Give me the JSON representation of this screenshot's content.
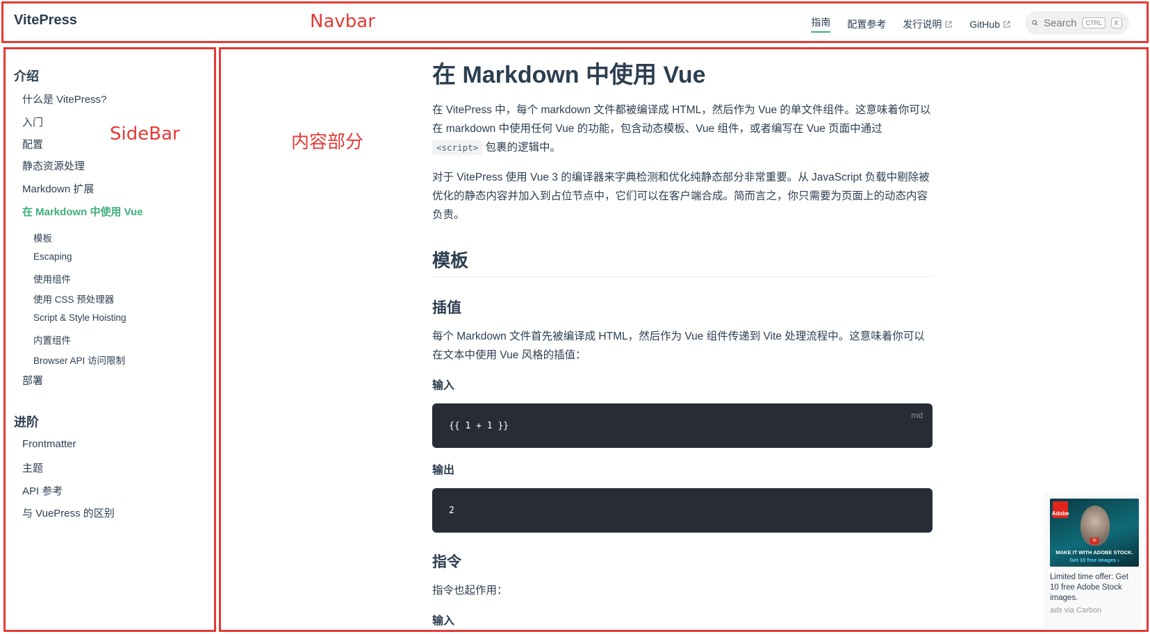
{
  "navbar": {
    "brand": "VitePress",
    "links": [
      {
        "label": "指南",
        "active": true,
        "external": false
      },
      {
        "label": "配置参考",
        "active": false,
        "external": false
      },
      {
        "label": "发行说明",
        "active": false,
        "external": true
      },
      {
        "label": "GitHub",
        "active": false,
        "external": true
      }
    ],
    "search": {
      "label": "Search",
      "kbd_ctrl": "CTRL",
      "kbd_key": "K"
    }
  },
  "annotations": {
    "navbar": "Navbar",
    "sidebar": "SideBar",
    "content": "内容部分"
  },
  "sidebar": {
    "groups": [
      {
        "title": "介绍",
        "items": [
          {
            "label": "什么是 VitePress?"
          },
          {
            "label": "入门"
          },
          {
            "label": "配置"
          },
          {
            "label": "静态资源处理"
          },
          {
            "label": "Markdown 扩展"
          },
          {
            "label": "在 Markdown 中使用 Vue",
            "active": true
          },
          {
            "label": "部署"
          }
        ],
        "sub_items": [
          "模板",
          "Escaping",
          "使用组件",
          "使用 CSS 预处理器",
          "Script & Style Hoisting",
          "内置组件",
          "Browser API 访问限制"
        ]
      },
      {
        "title": "进阶",
        "items": [
          {
            "label": "Frontmatter"
          },
          {
            "label": "主题"
          },
          {
            "label": "API 参考"
          },
          {
            "label": "与 VuePress 的区别"
          }
        ]
      }
    ]
  },
  "content": {
    "title": "在 Markdown 中使用 Vue",
    "intro_part1": "在 VitePress 中，每个 markdown 文件都被编译成 HTML，然后作为 Vue 的单文件组件。这意味着你可以在 markdown 中使用任何 Vue 的功能，包含动态模板、Vue 组件，或者编写在 Vue 页面中通过",
    "intro_code": "<script>",
    "intro_part2": "包裹的逻辑中。",
    "para2": "对于 VitePress 使用 Vue 3 的编译器来字典检测和优化纯静态部分非常重要。从 JavaScript 负载中剔除被优化的静态内容并加入到占位节点中，它们可以在客户端合成。简而言之，你只需要为页面上的动态内容负责。",
    "h2_template": "模板",
    "h3_interp": "插值",
    "interp_para": "每个 Markdown 文件首先被编译成 HTML，然后作为 Vue 组件传递到 Vite 处理流程中。这意味着你可以在文本中使用 Vue 风格的插值：",
    "input_label": "输入",
    "code_input": "{{ 1 + 1 }}",
    "code_lang": "md",
    "output_label": "输出",
    "code_output": "2",
    "h3_directive": "指令",
    "directive_para": "指令也起作用：",
    "input_label2": "输入"
  },
  "ad": {
    "brand": "Adobe",
    "badge": "St",
    "headline": "MAKE IT WITH ADOBE STOCK.",
    "subline": "Get 10 free images ›",
    "text": "Limited time offer: Get 10 free Adobe Stock images.",
    "via": "ads via Carbon"
  }
}
